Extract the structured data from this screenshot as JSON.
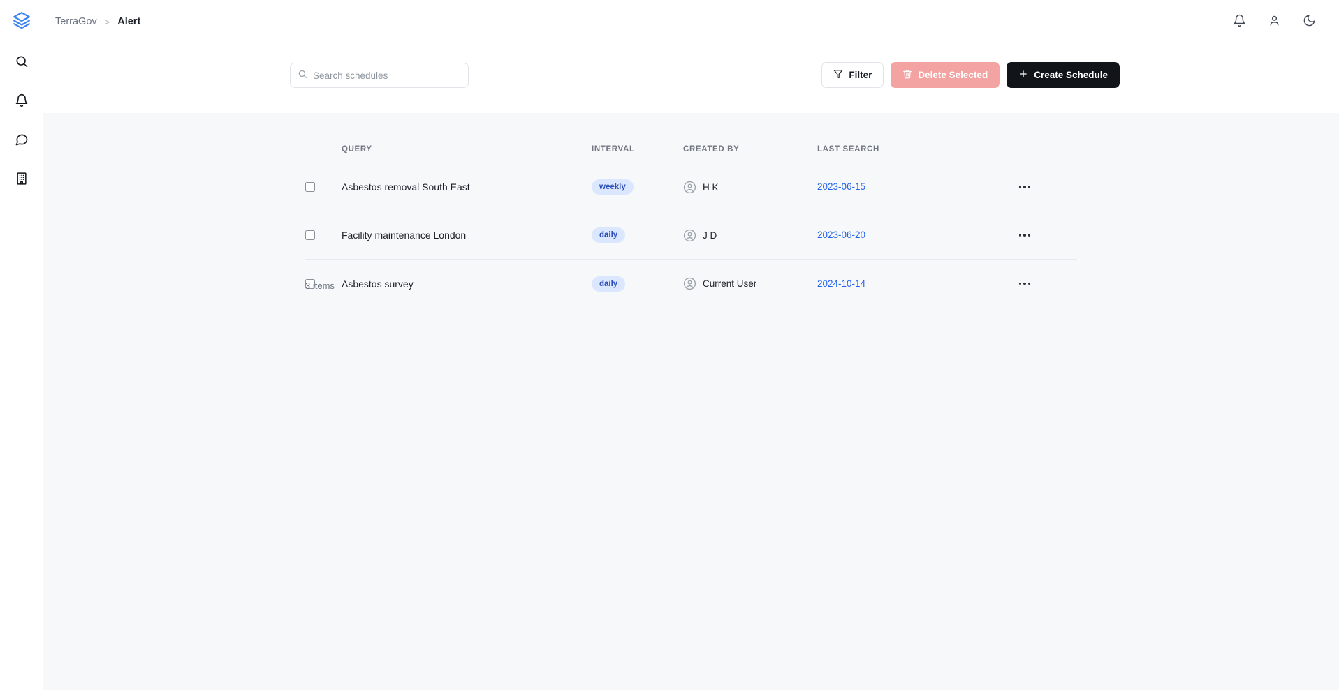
{
  "brand": {
    "logo_icon": "layers-icon"
  },
  "sidebar": {
    "items": [
      {
        "icon": "search-icon",
        "name": "search"
      },
      {
        "icon": "bell-icon",
        "name": "notifications"
      },
      {
        "icon": "chat-bubble-icon",
        "name": "messages"
      },
      {
        "icon": "building-icon",
        "name": "organisations"
      }
    ]
  },
  "header": {
    "breadcrumb": {
      "root": "TerraGov",
      "separator": ">",
      "current": "Alert"
    },
    "actions": [
      {
        "icon": "bell-icon",
        "name": "notifications"
      },
      {
        "icon": "user-icon",
        "name": "account"
      },
      {
        "icon": "moon-icon",
        "name": "dark-mode-toggle"
      }
    ]
  },
  "toolbar": {
    "search": {
      "placeholder": "Search schedules",
      "value": "",
      "icon": "search-icon"
    },
    "filter_label": "Filter",
    "delete_label": "Delete Selected",
    "create_label": "Create Schedule"
  },
  "table": {
    "columns": [
      "QUERY",
      "INTERVAL",
      "CREATED BY",
      "LAST SEARCH"
    ],
    "rows": [
      {
        "checked": false,
        "query": "Asbestos removal South East",
        "interval": "weekly",
        "created_by": "H K",
        "last_search": "2023-06-15"
      },
      {
        "checked": false,
        "query": "Facility maintenance London",
        "interval": "daily",
        "created_by": "J D",
        "last_search": "2023-06-20"
      },
      {
        "checked": false,
        "query": "Asbestos survey",
        "interval": "daily",
        "created_by": "Current User",
        "last_search": "2024-10-14"
      }
    ],
    "footer_count": "3 items"
  },
  "colors": {
    "brand_blue": "#3b82f6",
    "link_blue": "#2563eb",
    "badge_bg": "#dbe7fe",
    "badge_text": "#2c4fb8",
    "danger_disabled": "#f4a3a3",
    "primary_dark": "#111418",
    "content_bg": "#f7f8fa"
  }
}
